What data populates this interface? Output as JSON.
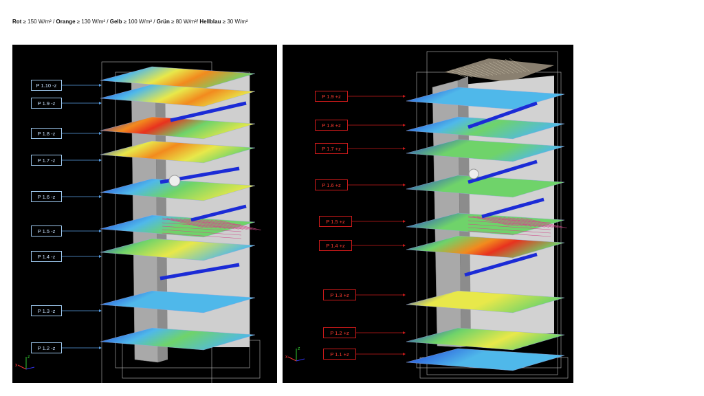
{
  "legend": {
    "items": [
      {
        "name": "Rot",
        "value": "≥ 150 W/m²",
        "sep": " / "
      },
      {
        "name": "Orange",
        "value": "≥ 130 W/m²",
        "sep": " / "
      },
      {
        "name": "Gelb",
        "value": "≥ 100 W/m²",
        "sep": " / "
      },
      {
        "name": "Grün",
        "value": "≥ 80 W/m²",
        "sep": "/ "
      },
      {
        "name": "Hellblau",
        "value": "≥ 30 W/m²",
        "sep": ""
      }
    ]
  },
  "colors": {
    "red": "#e8321e",
    "orange": "#f28a1e",
    "yellow": "#e8e84a",
    "green": "#6fd36a",
    "lightblue": "#4fb8ea",
    "blue": "#1e3cd8",
    "building": "#a9a9a9",
    "minus_label": "#9ec8ee",
    "plus_label": "#cc1a1a"
  },
  "panels": {
    "left": {
      "labels": [
        "P 1.10 -z",
        "P 1.9 -z",
        "P 1.8 -z",
        "P 1.7 -z",
        "P 1.6 -z",
        "P 1.5 -z",
        "P 1.4 -z",
        "P 1.3 -z",
        "P 1.2 -z"
      ],
      "axes": {
        "z": "z",
        "x": "x"
      }
    },
    "right": {
      "labels": [
        "P 1.9 +z",
        "P 1.8 +z",
        "P 1.7 +z",
        "P 1.6 +z",
        "P 1.5 +z",
        "P 1.4 +z",
        "P 1.3 +z",
        "P 1.2 +z",
        "P 1.1 +z"
      ],
      "axes": {
        "z": "z",
        "x": "x"
      }
    }
  }
}
